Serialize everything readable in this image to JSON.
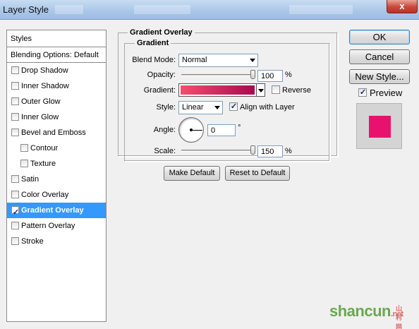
{
  "window": {
    "title": "Layer Style",
    "close_label": "x"
  },
  "styles_panel": {
    "header": "Styles",
    "blending_default": "Blending Options: Default",
    "items": [
      {
        "label": "Drop Shadow",
        "checked": false
      },
      {
        "label": "Inner Shadow",
        "checked": false
      },
      {
        "label": "Outer Glow",
        "checked": false
      },
      {
        "label": "Inner Glow",
        "checked": false
      },
      {
        "label": "Bevel and Emboss",
        "checked": false
      },
      {
        "label": "Contour",
        "checked": false
      },
      {
        "label": "Texture",
        "checked": false
      },
      {
        "label": "Satin",
        "checked": false
      },
      {
        "label": "Color Overlay",
        "checked": false
      },
      {
        "label": "Gradient Overlay",
        "checked": true
      },
      {
        "label": "Pattern Overlay",
        "checked": false
      },
      {
        "label": "Stroke",
        "checked": false
      }
    ]
  },
  "gradient_overlay": {
    "group_title": "Gradient Overlay",
    "subgroup_title": "Gradient",
    "blend_mode": {
      "label": "Blend Mode:",
      "value": "Normal"
    },
    "opacity": {
      "label": "Opacity:",
      "value": "100",
      "unit": "%",
      "fraction": 1.0
    },
    "gradient": {
      "label": "Gradient:",
      "reverse_label": "Reverse",
      "reverse_checked": false,
      "color_start": "#f44e6f",
      "color_end": "#a80a4f"
    },
    "style": {
      "label": "Style:",
      "value": "Linear",
      "align_label": "Align with Layer",
      "align_checked": true
    },
    "angle": {
      "label": "Angle:",
      "value": "0",
      "unit": "°"
    },
    "scale": {
      "label": "Scale:",
      "value": "150",
      "unit": "%",
      "fraction": 1.0
    },
    "make_default": "Make Default",
    "reset_default": "Reset to Default"
  },
  "actions": {
    "ok": "OK",
    "cancel": "Cancel",
    "new_style": "New Style...",
    "preview_label": "Preview",
    "preview_checked": true,
    "preview_color": "#e8126e"
  },
  "watermark": {
    "text": "shancun",
    "suffix": ".net",
    "cn": "山村网"
  },
  "colors": {
    "selection": "#3399ff",
    "titlebar": "#a9c6e8"
  }
}
